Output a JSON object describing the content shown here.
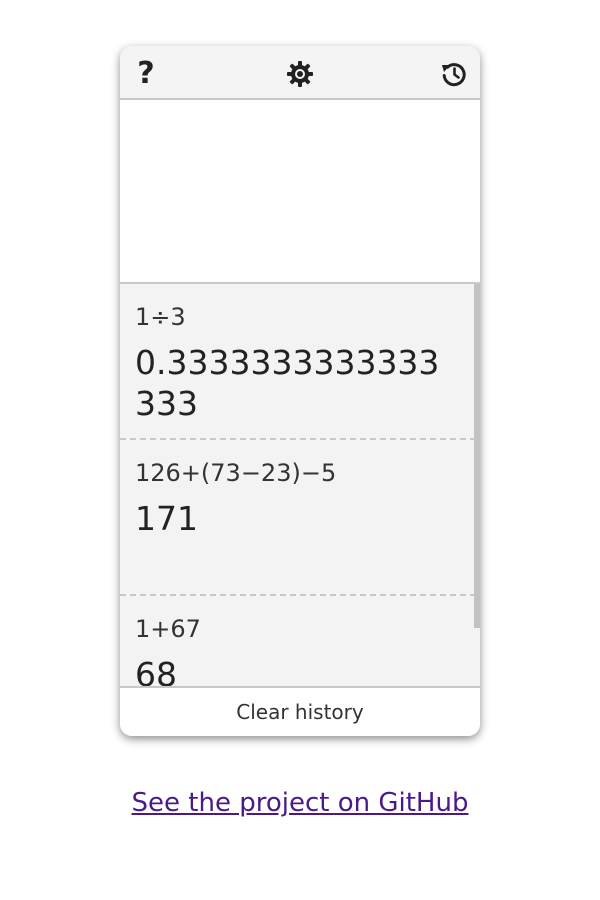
{
  "toolbar": {
    "help_label": "?",
    "help_icon": "help-icon",
    "settings_icon": "gear-icon",
    "history_icon": "history-icon"
  },
  "display": {
    "value": ""
  },
  "history": {
    "entries": [
      {
        "expression": "1÷3",
        "result": "0.3333333333333333"
      },
      {
        "expression": "126+(73−23)−5",
        "result": "171"
      },
      {
        "expression": "1+67",
        "result": "68"
      }
    ]
  },
  "footer": {
    "clear_label": "Clear history"
  },
  "links": {
    "github_label": "See the project on GitHub"
  },
  "colors": {
    "toolbar_bg": "#f4f4f4",
    "history_bg": "#f3f3f3",
    "link": "#4b1a8a"
  }
}
